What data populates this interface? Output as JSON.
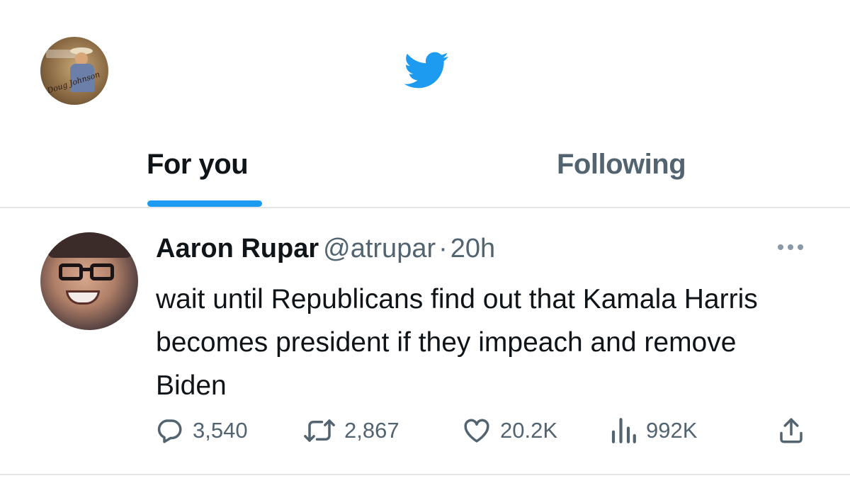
{
  "header": {
    "logo_icon": "twitter-bird-icon",
    "avatar_icon": "profile-avatar",
    "avatar_signature": "Doug Johnson",
    "accent_color": "#1d9bf0"
  },
  "tabs": [
    {
      "label": "For you",
      "active": true
    },
    {
      "label": "Following",
      "active": false
    }
  ],
  "tweet": {
    "author_name": "Aaron Rupar",
    "handle": "@atrupar",
    "separator": "·",
    "time": "20h",
    "text": "wait until Republicans find out that Kamala Harris becomes president if they impeach and remove Biden",
    "actions": {
      "replies": "3,540",
      "retweets": "2,867",
      "likes": "20.2K",
      "views": "992K"
    },
    "icons": [
      "reply-icon",
      "retweet-icon",
      "like-icon",
      "views-icon",
      "share-icon",
      "more-icon"
    ]
  }
}
